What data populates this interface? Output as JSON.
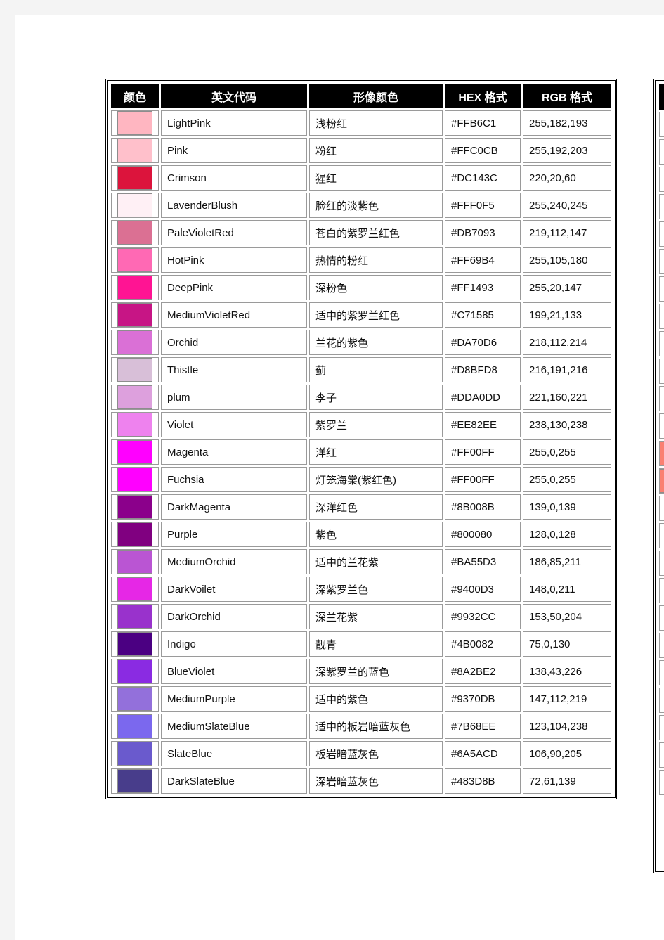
{
  "document": {
    "page_background": "#ffffff",
    "viewport_background": "#f4f4f4"
  },
  "table": {
    "name": "html-color-reference-table",
    "header_background": "#000000",
    "header_text_color": "#ffffff",
    "columns": [
      {
        "key": "swatch",
        "label": "颜色"
      },
      {
        "key": "name",
        "label": "英文代码"
      },
      {
        "key": "cn",
        "label": "形像颜色"
      },
      {
        "key": "hex",
        "label": "HEX 格式"
      },
      {
        "key": "rgb",
        "label": "RGB 格式"
      }
    ],
    "rows": [
      {
        "name": "LightPink",
        "cn": "浅粉红",
        "hex": "#FFB6C1",
        "rgb": "255,182,193",
        "swatch": "#FFB6C1"
      },
      {
        "name": "Pink",
        "cn": "粉红",
        "hex": "#FFC0CB",
        "rgb": "255,192,203",
        "swatch": "#FFC0CB"
      },
      {
        "name": "Crimson",
        "cn": "猩红",
        "hex": "#DC143C",
        "rgb": "220,20,60",
        "swatch": "#DC143C"
      },
      {
        "name": "LavenderBlush",
        "cn": "脸红的淡紫色",
        "hex": "#FFF0F5",
        "rgb": "255,240,245",
        "swatch": "#FFF0F5"
      },
      {
        "name": "PaleVioletRed",
        "cn": "苍白的紫罗兰红色",
        "hex": "#DB7093",
        "rgb": "219,112,147",
        "swatch": "#DB7093"
      },
      {
        "name": "HotPink",
        "cn": "热情的粉红",
        "hex": "#FF69B4",
        "rgb": "255,105,180",
        "swatch": "#FF69B4"
      },
      {
        "name": "DeepPink",
        "cn": "深粉色",
        "hex": "#FF1493",
        "rgb": "255,20,147",
        "swatch": "#FF1493"
      },
      {
        "name": "MediumVioletRed",
        "cn": "适中的紫罗兰红色",
        "hex": "#C71585",
        "rgb": "199,21,133",
        "swatch": "#C71585"
      },
      {
        "name": "Orchid",
        "cn": "兰花的紫色",
        "hex": "#DA70D6",
        "rgb": "218,112,214",
        "swatch": "#DA70D6"
      },
      {
        "name": "Thistle",
        "cn": "蓟",
        "hex": "#D8BFD8",
        "rgb": "216,191,216",
        "swatch": "#D8BFD8"
      },
      {
        "name": "plum",
        "cn": "李子",
        "hex": "#DDA0DD",
        "rgb": "221,160,221",
        "swatch": "#DDA0DD"
      },
      {
        "name": "Violet",
        "cn": "紫罗兰",
        "hex": "#EE82EE",
        "rgb": "238,130,238",
        "swatch": "#EE82EE"
      },
      {
        "name": "Magenta",
        "cn": "洋红",
        "hex": "#FF00FF",
        "rgb": "255,0,255",
        "swatch": "#FF00FF"
      },
      {
        "name": "Fuchsia",
        "cn": "灯笼海棠(紫红色)",
        "hex": "#FF00FF",
        "rgb": "255,0,255",
        "swatch": "#FF00FF"
      },
      {
        "name": "DarkMagenta",
        "cn": "深洋红色",
        "hex": "#8B008B",
        "rgb": "139,0,139",
        "swatch": "#8B008B"
      },
      {
        "name": "Purple",
        "cn": "紫色",
        "hex": "#800080",
        "rgb": "128,0,128",
        "swatch": "#800080"
      },
      {
        "name": "MediumOrchid",
        "cn": "适中的兰花紫",
        "hex": "#BA55D3",
        "rgb": "186,85,211",
        "swatch": "#BA55D3"
      },
      {
        "name": "DarkVoilet",
        "cn": "深紫罗兰色",
        "hex": "#9400D3",
        "rgb": "148,0,211",
        "swatch": "#E627E6"
      },
      {
        "name": "DarkOrchid",
        "cn": "深兰花紫",
        "hex": "#9932CC",
        "rgb": "153,50,204",
        "swatch": "#9932CC"
      },
      {
        "name": "Indigo",
        "cn": "靓青",
        "hex": "#4B0082",
        "rgb": "75,0,130",
        "swatch": "#4B0082"
      },
      {
        "name": "BlueViolet",
        "cn": "深紫罗兰的蓝色",
        "hex": "#8A2BE2",
        "rgb": "138,43,226",
        "swatch": "#8A2BE2"
      },
      {
        "name": "MediumPurple",
        "cn": "适中的紫色",
        "hex": "#9370DB",
        "rgb": "147,112,219",
        "swatch": "#9370DB"
      },
      {
        "name": "MediumSlateBlue",
        "cn": "适中的板岩暗蓝灰色",
        "hex": "#7B68EE",
        "rgb": "123,104,238",
        "swatch": "#7B68EE"
      },
      {
        "name": "SlateBlue",
        "cn": "板岩暗蓝灰色",
        "hex": "#6A5ACD",
        "rgb": "106,90,205",
        "swatch": "#6A5ACD"
      },
      {
        "name": "DarkSlateBlue",
        "cn": "深岩暗蓝灰色",
        "hex": "#483D8B",
        "rgb": "72,61,139",
        "swatch": "#483D8B"
      }
    ]
  },
  "side_table": {
    "name": "adjacent-clipped-color-table",
    "rows": [
      {
        "swatch": "#ffffff"
      },
      {
        "swatch": "#ffffff"
      },
      {
        "swatch": "#ffffff"
      },
      {
        "swatch": "#ffffff"
      },
      {
        "swatch": "#ffffff"
      },
      {
        "swatch": "#ffffff"
      },
      {
        "swatch": "#ffffff"
      },
      {
        "swatch": "#ffffff"
      },
      {
        "swatch": "#ffffff"
      },
      {
        "swatch": "#ffffff"
      },
      {
        "swatch": "#ffffff"
      },
      {
        "swatch": "#ffffff"
      },
      {
        "swatch": "#FA8072"
      },
      {
        "swatch": "#FA8072"
      },
      {
        "swatch": "#ffffff"
      },
      {
        "swatch": "#ffffff"
      },
      {
        "swatch": "#ffffff"
      },
      {
        "swatch": "#ffffff"
      },
      {
        "swatch": "#ffffff"
      },
      {
        "swatch": "#ffffff"
      },
      {
        "swatch": "#ffffff"
      },
      {
        "swatch": "#ffffff"
      },
      {
        "swatch": "#ffffff"
      },
      {
        "swatch": "#ffffff"
      },
      {
        "swatch": "#ffffff"
      }
    ]
  }
}
